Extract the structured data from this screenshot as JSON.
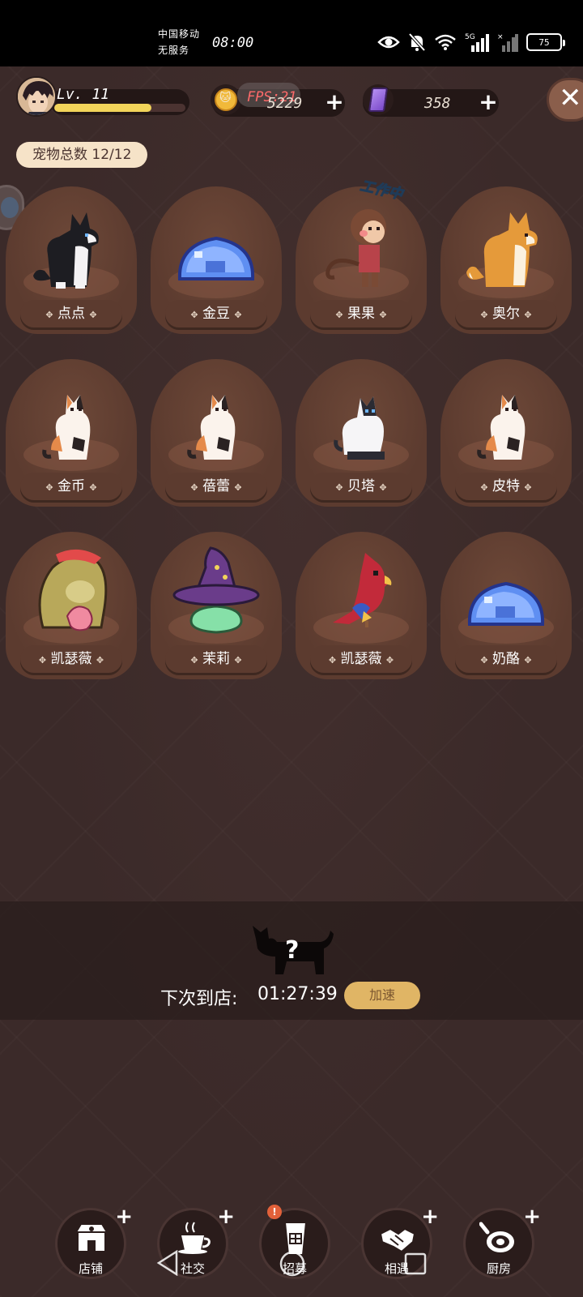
{
  "status_bar": {
    "carrier_line1": "中国移动",
    "carrier_line2": "无服务",
    "time": "08:00",
    "network": "5G",
    "battery": "75",
    "icons": [
      "eye-icon",
      "mute-bell-icon",
      "wifi-icon",
      "signal-icon",
      "signal-x-icon",
      "battery-icon"
    ]
  },
  "hud": {
    "level": "Lv. 11",
    "xp_fraction": 0.74,
    "fps_overlay": "FPS:21",
    "coins": "5229",
    "gems": "358",
    "plus": "+",
    "close": "✕"
  },
  "pet_count": "宠物总数 12/12",
  "pets": [
    {
      "name": "点点",
      "kind": "husky"
    },
    {
      "name": "金豆",
      "kind": "blue-slime"
    },
    {
      "name": "果果",
      "kind": "monkey",
      "tag": "工作中"
    },
    {
      "name": "奥尔",
      "kind": "shiba"
    },
    {
      "name": "金币",
      "kind": "calico-cat"
    },
    {
      "name": "蓓蕾",
      "kind": "calico-cat"
    },
    {
      "name": "贝塔",
      "kind": "white-cat"
    },
    {
      "name": "皮特",
      "kind": "calico-cat"
    },
    {
      "name": "凯瑟薇",
      "kind": "hooded-creature"
    },
    {
      "name": "茉莉",
      "kind": "witch-hat-slime"
    },
    {
      "name": "凯瑟薇",
      "kind": "red-parrot"
    },
    {
      "name": "奶酪",
      "kind": "blue-slime"
    }
  ],
  "arrival": {
    "label": "下次到店:",
    "time": "01:27:39",
    "speedup": "加速",
    "mystery": "?"
  },
  "nav": [
    {
      "label": "店铺",
      "icon": "shop-icon"
    },
    {
      "label": "社交",
      "icon": "coffee-cup-icon"
    },
    {
      "label": "招募",
      "icon": "recruit-drink-icon",
      "badge": "!"
    },
    {
      "label": "相遇",
      "icon": "handshake-icon"
    },
    {
      "label": "厨房",
      "icon": "frying-pan-icon"
    }
  ],
  "colors": {
    "background": "#3b2a29",
    "card": "#5c3b2f",
    "accent_gold": "#e0b565",
    "xp_bar": "#f2d45a",
    "gem_purple": "#8b5ad6"
  }
}
